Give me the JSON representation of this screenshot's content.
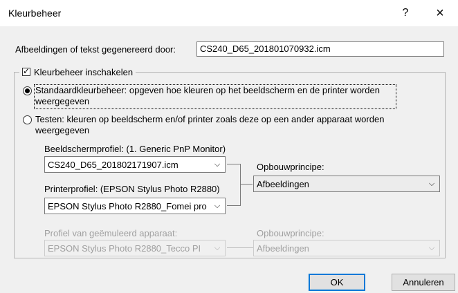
{
  "window": {
    "title": "Kleurbeheer",
    "help_glyph": "?",
    "close_glyph": "×"
  },
  "generated_by": {
    "label": "Afbeeldingen of tekst gegenereerd door:",
    "value": "CS240_D65_201801070932.icm"
  },
  "color_management": {
    "checkbox_label": "Kleurbeheer inschakelen",
    "checked": true
  },
  "options": {
    "standard": {
      "label_line1": "Standaardkleurbeheer: opgeven hoe kleuren op het beeldscherm en de printer worden",
      "label_line2": "weergegeven",
      "selected": true
    },
    "proofing": {
      "label_line1": "Testen: kleuren op beeldscherm en/of printer zoals deze op een ander apparaat worden",
      "label_line2": "weergegeven",
      "selected": false
    }
  },
  "monitor_profile": {
    "label": "Beeldschermprofiel: (1. Generic PnP Monitor)",
    "value": "CS240_D65_201802171907.icm"
  },
  "printer_profile": {
    "label": "Printerprofiel: (EPSON Stylus Photo R2880)",
    "value": "EPSON Stylus Photo R2880_Fomei pro"
  },
  "rendering_intent": {
    "label": "Opbouwprincipe:",
    "value": "Afbeeldingen"
  },
  "emulated_device": {
    "label": "Profiel van geëmuleerd apparaat:",
    "value": "EPSON Stylus Photo R2880_Tecco PI"
  },
  "emulated_intent": {
    "label": "Opbouwprincipe:",
    "value": "Afbeeldingen"
  },
  "buttons": {
    "ok": "OK",
    "cancel": "Annuleren"
  },
  "chevron_glyph": "⌵"
}
